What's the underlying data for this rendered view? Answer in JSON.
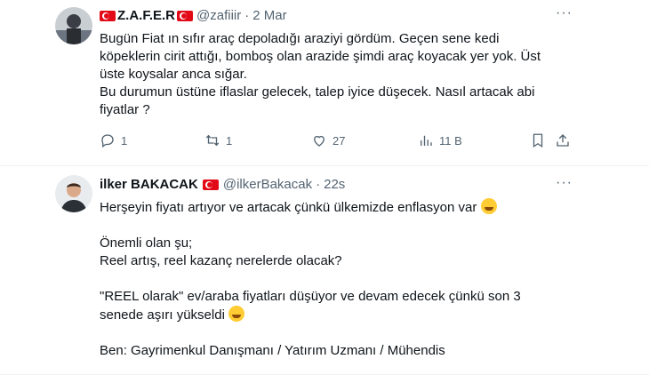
{
  "tweet1": {
    "name": "Z.A.F.E.R",
    "handle": "@zafiiir",
    "time": "2 Mar",
    "more": "···",
    "lines": [
      "Bugün Fiat ın sıfır araç depoladığı araziyi gördüm. Geçen sene kedi",
      "köpeklerin cirit attığı, bomboş olan arazide şimdi araç koyacak yer yok. Üst",
      "üste koysalar anca sığar.",
      "Bu durumun üstüne iflaslar gelecek, talep iyice düşecek. Nasıl artacak abi",
      "fiyatlar ?"
    ],
    "actions": {
      "reply_count": "1",
      "retweet_count": "1",
      "like_count": "27",
      "views_count": "11 B"
    }
  },
  "tweet2": {
    "name": "ilker BAKACAK",
    "handle": "@ilkerBakacak",
    "time": "22s",
    "more": "···",
    "lines": [
      "Herşeyin fiyatı artıyor ve artacak çünkü ülkemizde enflasyon var",
      "",
      "Önemli olan şu;",
      "Reel artış, reel kazanç nerelerde olacak?",
      "",
      "\"REEL olarak\" ev/araba fiyatları düşüyor ve devam edecek çünkü son 3",
      "senede aşırı yükseldi",
      "",
      "Ben: Gayrimenkul Danışmanı / Yatırım Uzmanı / Mühendis"
    ]
  },
  "colors": {
    "text": "#0f1419",
    "muted": "#536471",
    "flag": "#e30a17"
  },
  "icons": [
    "reply-icon",
    "retweet-icon",
    "like-icon",
    "views-icon",
    "bookmark-icon",
    "share-icon",
    "turkish-flag-icon",
    "laughing-emoji",
    "winking-emoji"
  ]
}
